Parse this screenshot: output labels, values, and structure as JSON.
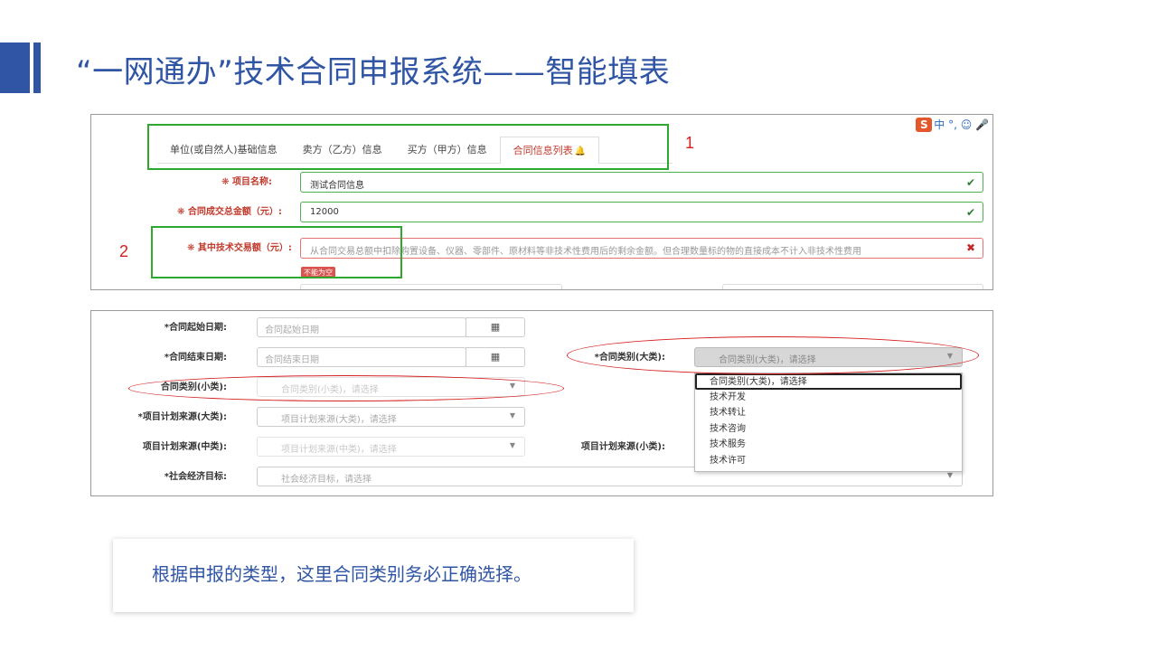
{
  "slide": {
    "title": "“一网通办”技术合同申报系统——智能填表",
    "note": "根据申报的类型，这里合同类别务必正确选择。",
    "accent_color": "#2f55a4"
  },
  "callouts": {
    "one": "1",
    "two": "2"
  },
  "ime": {
    "logo": "S",
    "text": "中 °, ☺ 🎤"
  },
  "form1": {
    "tabs": [
      {
        "label": "单位(或自然人)基础信息"
      },
      {
        "label": "卖方（乙方）信息"
      },
      {
        "label": "买方（甲方）信息"
      },
      {
        "label": "合同信息列表"
      }
    ],
    "fields": {
      "project_name": {
        "label": "项目名称:",
        "value": "测试合同信息"
      },
      "total_amount": {
        "label": "合同成交总金额（元）:",
        "value": "12000"
      },
      "tech_amount": {
        "label": "其中技术交易额（元）:",
        "placeholder": "从合同交易总额中扣除购置设备、仪器、零部件、原材料等非技术性费用后的剩余金额。但合理数量标的物的直接成本不计入非技术性费用",
        "error": "不能为空"
      }
    }
  },
  "form2": {
    "start_date": {
      "label": "*合同起始日期:",
      "placeholder": "合同起始日期"
    },
    "end_date": {
      "label": "*合同结束日期:",
      "placeholder": "合同结束日期"
    },
    "category_major": {
      "label": "*合同类别(大类):",
      "placeholder": "合同类别(大类)，请选择"
    },
    "category_minor": {
      "label": "合同类别(小类):",
      "placeholder": "合同类别(小类)，请选择"
    },
    "plan_source_major": {
      "label": "*项目计划来源(大类):",
      "placeholder": "项目计划来源(大类)，请选择"
    },
    "plan_source_mid": {
      "label": "项目计划来源(中类):",
      "placeholder": "项目计划来源(中类)，请选择"
    },
    "plan_source_minor": {
      "label": "项目计划来源(小类):"
    },
    "social_goal": {
      "label": "*社会经济目标:",
      "placeholder": "社会经济目标，请选择"
    },
    "dropdown_options": [
      "合同类别(大类)，请选择",
      "技术开发",
      "技术转让",
      "技术咨询",
      "技术服务",
      "技术许可"
    ]
  }
}
